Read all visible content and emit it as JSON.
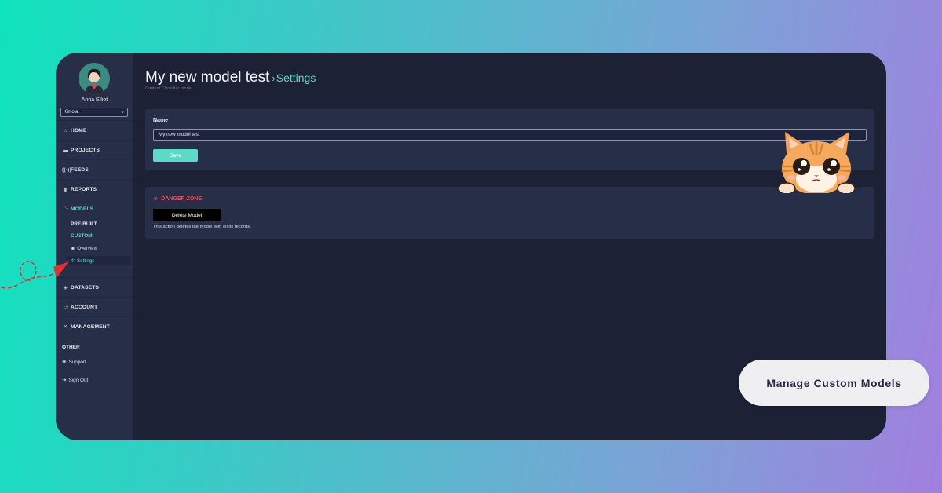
{
  "user": {
    "name": "Anna Elliot",
    "org": "Kimola"
  },
  "nav": {
    "home": "HOME",
    "projects": "PROJECTS",
    "feeds": "FEEDS",
    "reports": "REPORTS",
    "models": "MODELS",
    "prebuilt": "PRE-BUILT",
    "custom": "CUSTOM",
    "overview": "Overview",
    "settings": "Settings",
    "datasets": "DATASETS",
    "account": "ACCOUNT",
    "management": "MANAGEMENT",
    "other": "OTHER",
    "support": "Support",
    "signout": "Sign Out"
  },
  "header": {
    "title": "My new model test",
    "breadcrumb_sep": "›",
    "breadcrumb": "Settings",
    "subtitle": "Content Classifier model"
  },
  "name_card": {
    "label": "Name",
    "value": "My new model test",
    "save_label": "Save"
  },
  "danger": {
    "title": "DANGER ZONE",
    "delete_label": "Delete Model",
    "description": "This action deletes the model with all its records."
  },
  "promo": {
    "label": "Manage Custom Models"
  },
  "colors": {
    "accent": "#5fd9c7",
    "danger": "#e0505e",
    "panel": "#1c2136",
    "sidebar": "#272e48"
  }
}
